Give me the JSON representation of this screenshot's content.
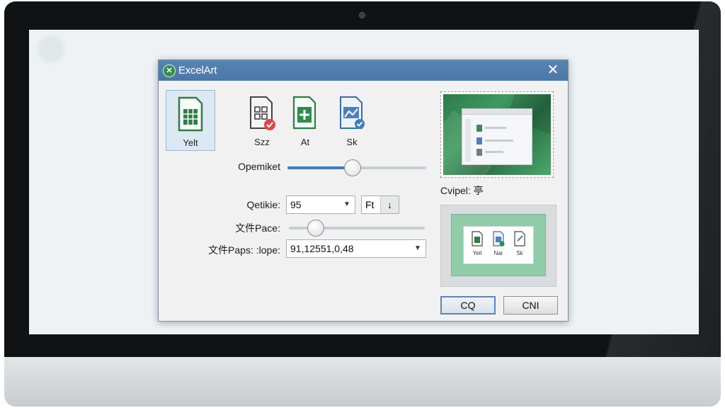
{
  "dialog": {
    "title": "ExcelArt",
    "close_glyph": "✕",
    "app_icon_glyph": "✕"
  },
  "formats": [
    {
      "label": "Yelt",
      "icon": "spreadsheet-icon",
      "selected": true
    },
    {
      "label": "Szz",
      "icon": "spreadsheet-shield-icon",
      "selected": false
    },
    {
      "label": "At",
      "icon": "spreadsheet-add-icon",
      "selected": false
    },
    {
      "label": "Sk",
      "icon": "image-check-icon",
      "selected": false
    }
  ],
  "settings": {
    "opacity_label": "Opemiket",
    "opacity_value_fraction": 0.47,
    "quality_label": "Qetikie:",
    "quality_value": "95",
    "unit_value": "Ft",
    "unit_spin_glyph": "↓",
    "page_label": "文件Pace:",
    "page_value_fraction": 0.2,
    "path_label": "文件Paps: :lope:",
    "path_value": "91,12551,0,48"
  },
  "preview": {
    "caption": "Cvipel: 亭",
    "card_labels": [
      "Yeil",
      "Nar",
      "Sk"
    ]
  },
  "buttons": {
    "ok_label": "CQ",
    "cancel_label": "CNI"
  },
  "colors": {
    "titlebar": "#4f7bab",
    "excel_green": "#2e7d46",
    "accent_blue": "#3d7cc2"
  }
}
